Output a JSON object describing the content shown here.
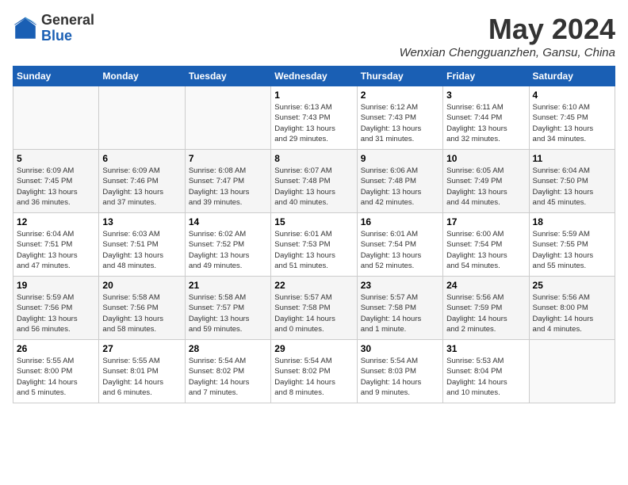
{
  "header": {
    "logo_general": "General",
    "logo_blue": "Blue",
    "month_title": "May 2024",
    "location": "Wenxian Chengguanzhen, Gansu, China"
  },
  "days_of_week": [
    "Sunday",
    "Monday",
    "Tuesday",
    "Wednesday",
    "Thursday",
    "Friday",
    "Saturday"
  ],
  "weeks": [
    [
      {
        "day": "",
        "info": ""
      },
      {
        "day": "",
        "info": ""
      },
      {
        "day": "",
        "info": ""
      },
      {
        "day": "1",
        "info": "Sunrise: 6:13 AM\nSunset: 7:43 PM\nDaylight: 13 hours\nand 29 minutes."
      },
      {
        "day": "2",
        "info": "Sunrise: 6:12 AM\nSunset: 7:43 PM\nDaylight: 13 hours\nand 31 minutes."
      },
      {
        "day": "3",
        "info": "Sunrise: 6:11 AM\nSunset: 7:44 PM\nDaylight: 13 hours\nand 32 minutes."
      },
      {
        "day": "4",
        "info": "Sunrise: 6:10 AM\nSunset: 7:45 PM\nDaylight: 13 hours\nand 34 minutes."
      }
    ],
    [
      {
        "day": "5",
        "info": "Sunrise: 6:09 AM\nSunset: 7:45 PM\nDaylight: 13 hours\nand 36 minutes."
      },
      {
        "day": "6",
        "info": "Sunrise: 6:09 AM\nSunset: 7:46 PM\nDaylight: 13 hours\nand 37 minutes."
      },
      {
        "day": "7",
        "info": "Sunrise: 6:08 AM\nSunset: 7:47 PM\nDaylight: 13 hours\nand 39 minutes."
      },
      {
        "day": "8",
        "info": "Sunrise: 6:07 AM\nSunset: 7:48 PM\nDaylight: 13 hours\nand 40 minutes."
      },
      {
        "day": "9",
        "info": "Sunrise: 6:06 AM\nSunset: 7:48 PM\nDaylight: 13 hours\nand 42 minutes."
      },
      {
        "day": "10",
        "info": "Sunrise: 6:05 AM\nSunset: 7:49 PM\nDaylight: 13 hours\nand 44 minutes."
      },
      {
        "day": "11",
        "info": "Sunrise: 6:04 AM\nSunset: 7:50 PM\nDaylight: 13 hours\nand 45 minutes."
      }
    ],
    [
      {
        "day": "12",
        "info": "Sunrise: 6:04 AM\nSunset: 7:51 PM\nDaylight: 13 hours\nand 47 minutes."
      },
      {
        "day": "13",
        "info": "Sunrise: 6:03 AM\nSunset: 7:51 PM\nDaylight: 13 hours\nand 48 minutes."
      },
      {
        "day": "14",
        "info": "Sunrise: 6:02 AM\nSunset: 7:52 PM\nDaylight: 13 hours\nand 49 minutes."
      },
      {
        "day": "15",
        "info": "Sunrise: 6:01 AM\nSunset: 7:53 PM\nDaylight: 13 hours\nand 51 minutes."
      },
      {
        "day": "16",
        "info": "Sunrise: 6:01 AM\nSunset: 7:54 PM\nDaylight: 13 hours\nand 52 minutes."
      },
      {
        "day": "17",
        "info": "Sunrise: 6:00 AM\nSunset: 7:54 PM\nDaylight: 13 hours\nand 54 minutes."
      },
      {
        "day": "18",
        "info": "Sunrise: 5:59 AM\nSunset: 7:55 PM\nDaylight: 13 hours\nand 55 minutes."
      }
    ],
    [
      {
        "day": "19",
        "info": "Sunrise: 5:59 AM\nSunset: 7:56 PM\nDaylight: 13 hours\nand 56 minutes."
      },
      {
        "day": "20",
        "info": "Sunrise: 5:58 AM\nSunset: 7:56 PM\nDaylight: 13 hours\nand 58 minutes."
      },
      {
        "day": "21",
        "info": "Sunrise: 5:58 AM\nSunset: 7:57 PM\nDaylight: 13 hours\nand 59 minutes."
      },
      {
        "day": "22",
        "info": "Sunrise: 5:57 AM\nSunset: 7:58 PM\nDaylight: 14 hours\nand 0 minutes."
      },
      {
        "day": "23",
        "info": "Sunrise: 5:57 AM\nSunset: 7:58 PM\nDaylight: 14 hours\nand 1 minute."
      },
      {
        "day": "24",
        "info": "Sunrise: 5:56 AM\nSunset: 7:59 PM\nDaylight: 14 hours\nand 2 minutes."
      },
      {
        "day": "25",
        "info": "Sunrise: 5:56 AM\nSunset: 8:00 PM\nDaylight: 14 hours\nand 4 minutes."
      }
    ],
    [
      {
        "day": "26",
        "info": "Sunrise: 5:55 AM\nSunset: 8:00 PM\nDaylight: 14 hours\nand 5 minutes."
      },
      {
        "day": "27",
        "info": "Sunrise: 5:55 AM\nSunset: 8:01 PM\nDaylight: 14 hours\nand 6 minutes."
      },
      {
        "day": "28",
        "info": "Sunrise: 5:54 AM\nSunset: 8:02 PM\nDaylight: 14 hours\nand 7 minutes."
      },
      {
        "day": "29",
        "info": "Sunrise: 5:54 AM\nSunset: 8:02 PM\nDaylight: 14 hours\nand 8 minutes."
      },
      {
        "day": "30",
        "info": "Sunrise: 5:54 AM\nSunset: 8:03 PM\nDaylight: 14 hours\nand 9 minutes."
      },
      {
        "day": "31",
        "info": "Sunrise: 5:53 AM\nSunset: 8:04 PM\nDaylight: 14 hours\nand 10 minutes."
      },
      {
        "day": "",
        "info": ""
      }
    ]
  ]
}
